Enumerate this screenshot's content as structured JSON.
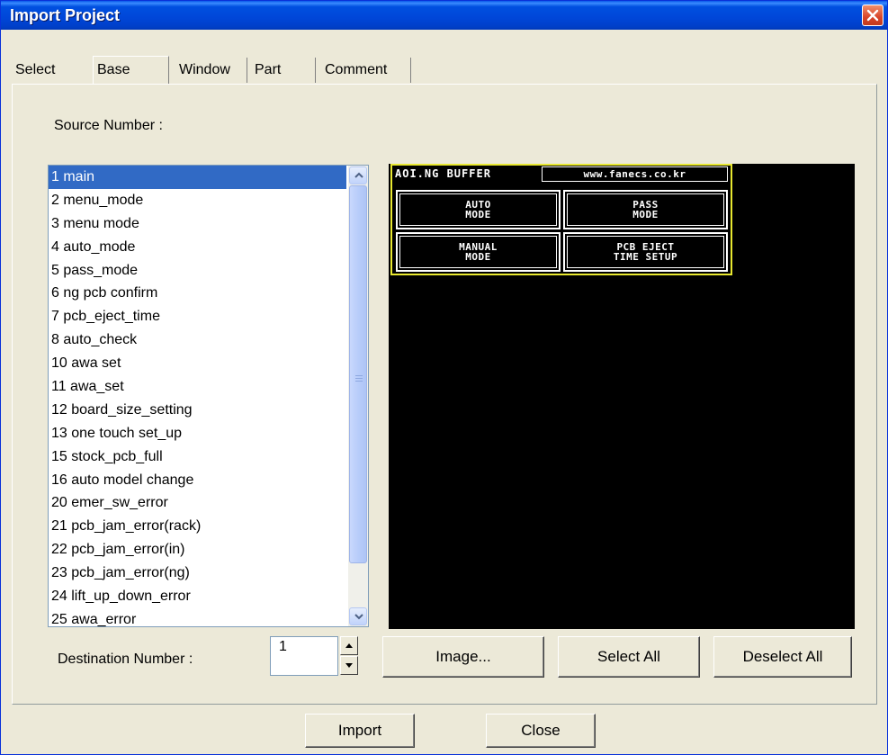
{
  "window": {
    "title": "Import Project"
  },
  "tabs": [
    {
      "label": "Select"
    },
    {
      "label": "Base"
    },
    {
      "label": "Window"
    },
    {
      "label": "Part"
    },
    {
      "label": "Comment"
    }
  ],
  "source_label": "Source Number :",
  "source_list": {
    "selected_index": 0,
    "items": [
      "1 main",
      "2 menu_mode",
      "3 menu mode",
      "4 auto_mode",
      "5 pass_mode",
      "6 ng pcb confirm",
      "7 pcb_eject_time",
      "8 auto_check",
      "10 awa set",
      "11 awa_set",
      "12 board_size_setting",
      "13 one touch set_up",
      "15 stock_pcb_full",
      "16 auto model change",
      "20 emer_sw_error",
      "21 pcb_jam_error(rack)",
      "22 pcb_jam_error(in)",
      "23 pcb_jam_error(ng)",
      "24 lift_up_down_error",
      "25 awa_error"
    ]
  },
  "preview": {
    "title": "AOI.NG BUFFER",
    "url": "www.fanecs.co.kr",
    "buttons": {
      "auto": [
        "AUTO",
        "MODE"
      ],
      "pass": [
        "PASS",
        "MODE"
      ],
      "manual": [
        "MANUAL",
        "MODE"
      ],
      "eject": [
        "PCB EJECT",
        "TIME SETUP"
      ]
    },
    "colors": {
      "frame": "#e8e830",
      "background": "#000000",
      "text": "#ffffff"
    }
  },
  "destination_label": "Destination Number :",
  "destination_value": "1",
  "buttons": {
    "image": "Image...",
    "select_all": "Select All",
    "deselect_all": "Deselect All",
    "import": "Import",
    "close": "Close"
  },
  "colors": {
    "titlebar": "#0046d8",
    "selection": "#316ac5",
    "dialog_bg": "#ece9d8"
  }
}
